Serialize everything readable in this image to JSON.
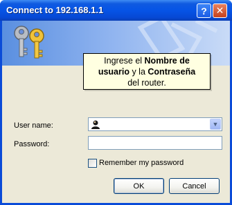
{
  "window": {
    "title": "Connect to 192.168.1.1",
    "help_symbol": "?",
    "close_symbol": "✕"
  },
  "callout": {
    "line1_prefix": "Ingrese el ",
    "line1_bold": "Nombre de",
    "line2_bold_a": "usuario",
    "line2_mid": " y la ",
    "line2_bold_b": "Contraseña",
    "line3": "del router."
  },
  "form": {
    "username_label": "User name:",
    "username_value": "",
    "password_label": "Password:",
    "password_value": "",
    "remember_label": "Remember my password",
    "remember_checked": false
  },
  "buttons": {
    "ok": "OK",
    "cancel": "Cancel"
  }
}
